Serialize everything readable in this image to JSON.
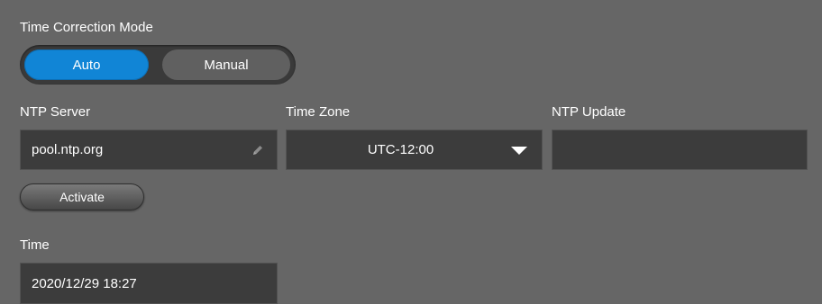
{
  "time_correction": {
    "label": "Time Correction Mode",
    "options": [
      "Auto",
      "Manual"
    ],
    "selected": "Auto"
  },
  "ntp_server": {
    "label": "NTP Server",
    "value": "pool.ntp.org",
    "icon": "pencil-icon"
  },
  "time_zone": {
    "label": "Time Zone",
    "value": "UTC-12:00",
    "icon": "caret-down-icon"
  },
  "ntp_update": {
    "label": "NTP Update",
    "value": ""
  },
  "activate": {
    "label": "Activate"
  },
  "time": {
    "label": "Time",
    "value": "2020/12/29 18:27"
  },
  "colors": {
    "background": "#666666",
    "field": "#3c3c3c",
    "accent": "#1185d6"
  }
}
